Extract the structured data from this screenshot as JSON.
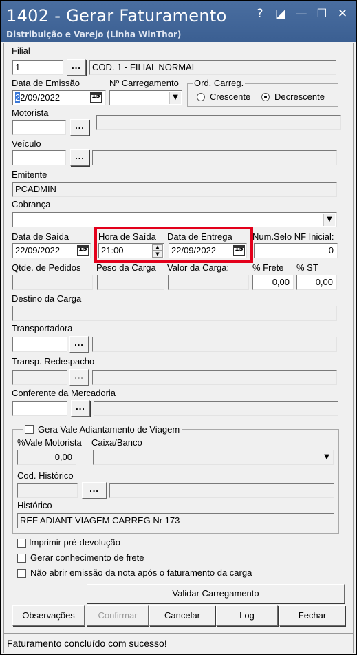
{
  "window": {
    "title": "1402 - Gerar Faturamento",
    "subtitle": "Distribuição e Varejo (Linha WinThor)",
    "help_glyph": "?",
    "restore_glyph": "◪",
    "minimize_glyph": "—",
    "maximize_glyph": "☐",
    "close_glyph": "✕"
  },
  "filial": {
    "label": "Filial",
    "value": "1",
    "description": "COD. 1 - FILIAL NORMAL"
  },
  "data_emissao": {
    "label": "Data de Emissão",
    "value": "22/09/2022"
  },
  "carregamento": {
    "label": "Nº Carregamento",
    "value": ""
  },
  "ord_carreg": {
    "label": "Ord. Carreg.",
    "options": [
      "Crescente",
      "Decrescente"
    ],
    "selected": "Decrescente"
  },
  "motorista": {
    "label": "Motorista",
    "value": "",
    "description": ""
  },
  "veiculo": {
    "label": "Veículo",
    "value": "",
    "description": ""
  },
  "emitente": {
    "label": "Emitente",
    "value": "PCADMIN"
  },
  "cobranca": {
    "label": "Cobrança",
    "value": ""
  },
  "data_saida": {
    "label": "Data de Saída",
    "value": "22/09/2022"
  },
  "hora_saida": {
    "label": "Hora de Saída",
    "value": "21:00"
  },
  "data_entrega": {
    "label": "Data de Entrega",
    "value": "22/09/2022"
  },
  "num_selo": {
    "label": "Num.Selo NF Inicial:",
    "value": "0"
  },
  "qtde_pedidos": {
    "label": "Qtde. de Pedidos",
    "value": ""
  },
  "peso_carga": {
    "label": "Peso da Carga",
    "value": ""
  },
  "valor_carga": {
    "label": "Valor da Carga:",
    "value": ""
  },
  "pct_frete": {
    "label": "% Frete",
    "value": "0,00"
  },
  "pct_st": {
    "label": "% ST",
    "value": "0,00"
  },
  "destino": {
    "label": "Destino da Carga",
    "value": ""
  },
  "transportadora": {
    "label": "Transportadora",
    "value": "",
    "description": ""
  },
  "transp_redespacho": {
    "label": "Transp. Redespacho",
    "value": "",
    "description": ""
  },
  "conferente": {
    "label": "Conferente da Mercadoria",
    "value": "",
    "description": ""
  },
  "vale": {
    "checkbox_label": "Gera Vale Adiantamento de Viagem",
    "motorista_label": "%Vale Motorista",
    "motorista_value": "0,00",
    "caixa_label": "Caixa/Banco",
    "caixa_value": "",
    "cod_historico_label": "Cod. Histórico",
    "cod_historico_value": "",
    "historico_label": "Histórico",
    "historico_value": "REF ADIANT VIAGEM CARREG Nr 173"
  },
  "options": {
    "imprimir": "Imprimir pré-devolução",
    "gerar_conhecimento": "Gerar conhecimento de frete",
    "nao_abrir": "Não abrir emissão da nota após o faturamento da carga"
  },
  "buttons": {
    "validar": "Validar Carregamento",
    "observacoes": "Observações",
    "confirmar": "Confirmar",
    "cancelar": "Cancelar",
    "log": "Log",
    "fechar": "Fechar"
  },
  "calendar_glyph": "15",
  "dots_glyph": "...",
  "status": "Faturamento concluído com sucesso!"
}
